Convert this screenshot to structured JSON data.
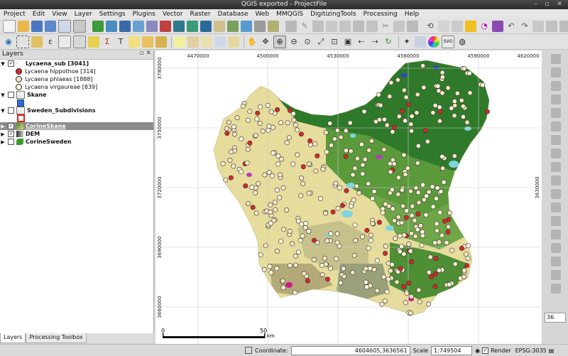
{
  "window": {
    "title": "QGIS exported - ProjectFile"
  },
  "menu": [
    "Project",
    "Edit",
    "View",
    "Layer",
    "Settings",
    "Plugins",
    "Vector",
    "Raster",
    "Database",
    "Web",
    "MMQGIS",
    "DigitizingTools",
    "Processing",
    "Help"
  ],
  "layers_panel": {
    "title": "Layers",
    "layers": [
      {
        "name": "Lycaena_sub [3041]",
        "checked": true,
        "expanded": true,
        "legend": [
          {
            "label": "Lycaena hippothoe [314]",
            "color": "#d62728"
          },
          {
            "label": "Lycaena phlaeas [1888]",
            "color": "#f7e7c4"
          },
          {
            "label": "Lycaena virgaureae [839]",
            "color": "#fbf5da"
          }
        ]
      },
      {
        "name": "Skane",
        "checked": false,
        "swatch": "#2f6fd1"
      },
      {
        "name": "Sweden_Subdivisions",
        "checked": false,
        "swatch": "#e82020"
      },
      {
        "name": "CorineSkane",
        "checked": true,
        "selected": true
      },
      {
        "name": "DEM",
        "checked": true
      },
      {
        "name": "CorineSweden",
        "checked": false
      }
    ]
  },
  "panel_tabs": [
    "Layers",
    "Processing Toolbox"
  ],
  "map": {
    "x_ticks": [
      "4470000",
      "4500000",
      "4530000",
      "4560000",
      "4590000",
      "4620000"
    ],
    "y_ticks": [
      "3630000",
      "3660000",
      "3690000",
      "3720000",
      "3750000",
      "3780000"
    ],
    "scalebar": {
      "start": "0",
      "end": "50",
      "unit": "km"
    }
  },
  "right_toolbar": {
    "value": "36"
  },
  "status": {
    "coordinate_label": "Coordinate:",
    "coordinate": "4604605,3636561",
    "scale_label": "Scale",
    "scale": "1:749504",
    "render_label": "Render",
    "crs": "EPSG:3035"
  }
}
